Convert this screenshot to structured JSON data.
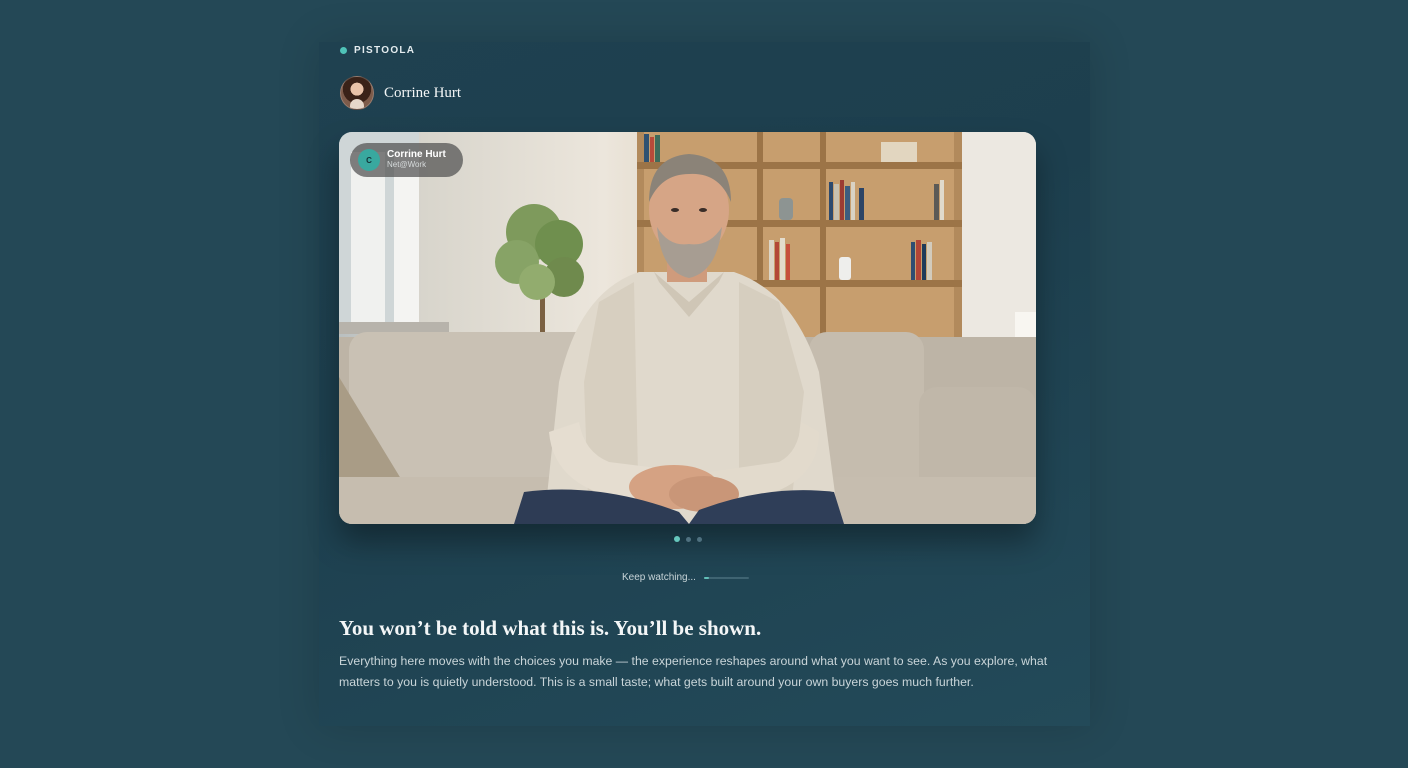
{
  "brand": {
    "name": "PISTOOLA",
    "accent_color": "#4fc3b8"
  },
  "author": {
    "name": "Corrine Hurt"
  },
  "video": {
    "chip": {
      "initial": "C",
      "name": "Corrine Hurt",
      "subtitle": "Net@Work"
    }
  },
  "carousel": {
    "dots": 3,
    "active_index": 0
  },
  "keep_watching": {
    "label": "Keep watching...",
    "progress": 0.12
  },
  "content": {
    "headline": "You won’t be told what this is. You’ll be shown.",
    "body": "Everything here moves with the choices you make — the experience reshapes around what you want to see. As you explore, what matters to you is quietly understood. This is a small taste; what gets built around your own buyers goes much further."
  }
}
